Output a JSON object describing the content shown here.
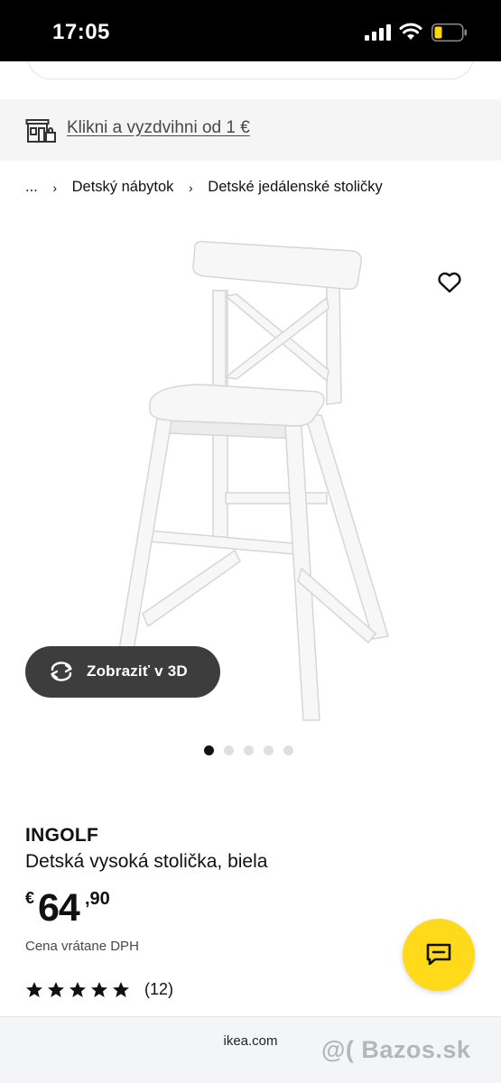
{
  "status_bar": {
    "time": "17:05"
  },
  "promo": {
    "link_text": "Klikni a vyzdvihni od 1 €",
    "icon": "store-pickup-icon"
  },
  "breadcrumb": {
    "items": [
      "...",
      "Detský nábytok",
      "Detské jedálenské stoličky"
    ],
    "separator": "›"
  },
  "gallery": {
    "view_3d_label": "Zobraziť v 3D",
    "pages_total": 5,
    "active_page": 1
  },
  "product": {
    "name": "INGOLF",
    "description": "Detská vysoká stolička, biela",
    "price": {
      "currency": "€",
      "integer": "64",
      "decimal": ",90"
    },
    "price_note": "Cena vrátane DPH",
    "rating": {
      "stars": 5,
      "count_label": "(12)"
    }
  },
  "browser": {
    "url": "ikea.com"
  },
  "watermark": "@( Bazos.sk",
  "colors": {
    "accent_yellow": "#ffda1a",
    "button_dark": "#3d3d3d",
    "status_bar": "#000000",
    "banner_bg": "#f5f5f5"
  }
}
